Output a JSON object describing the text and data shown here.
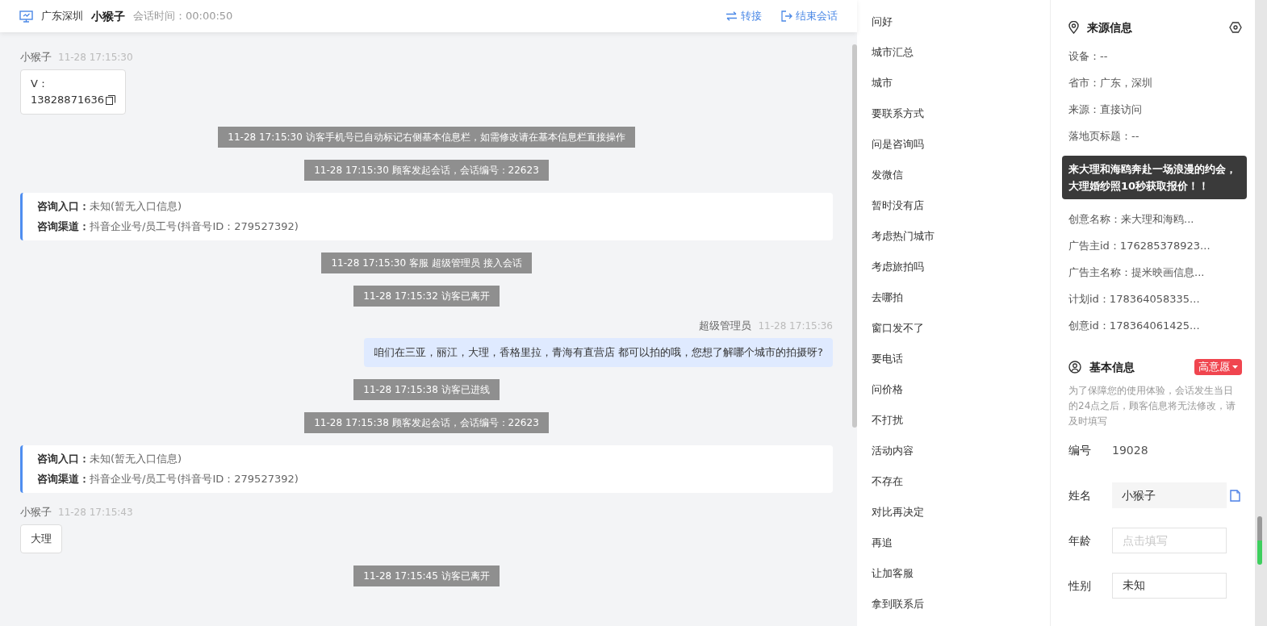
{
  "header": {
    "location": "广东深圳",
    "visitor": "小猴子",
    "timer_label": "会话时间：",
    "timer": "00:00:50",
    "actions": [
      {
        "kind": "transfer",
        "label": "转接"
      },
      {
        "kind": "end",
        "label": "结束会话"
      }
    ]
  },
  "messages": [
    {
      "kind": "visitor",
      "name": "小猴子",
      "time": "11-28 17:15:30",
      "lines": [
        "V：",
        "13828871636"
      ],
      "copyable": true
    },
    {
      "kind": "system",
      "text": "11-28 17:15:30 访客手机号已自动标记右侧基本信息栏，如需修改请在基本信息栏直接操作"
    },
    {
      "kind": "system",
      "text": "11-28 17:15:30 顾客发起会话，会话编号：22623"
    },
    {
      "kind": "info",
      "rows": [
        {
          "label": "咨询入口：",
          "value": "未知(暂无入口信息)"
        },
        {
          "label": "咨询渠道：",
          "value": "抖音企业号/员工号(抖音号ID：279527392)"
        }
      ]
    },
    {
      "kind": "system",
      "text": "11-28 17:15:30 客服 超级管理员 接入会话"
    },
    {
      "kind": "system",
      "text": "11-28 17:15:32 访客已离开"
    },
    {
      "kind": "agent",
      "name": "超级管理员",
      "time": "11-28 17:15:36",
      "lines": [
        "咱们在三亚，丽江，大理，香格里拉，青海有直营店 都可以拍的哦，您想了解哪个城市的拍摄呀?"
      ]
    },
    {
      "kind": "system",
      "text": "11-28 17:15:38 访客已进线"
    },
    {
      "kind": "system",
      "text": "11-28 17:15:38 顾客发起会话，会话编号：22623"
    },
    {
      "kind": "info",
      "rows": [
        {
          "label": "咨询入口：",
          "value": "未知(暂无入口信息)"
        },
        {
          "label": "咨询渠道：",
          "value": "抖音企业号/员工号(抖音号ID：279527392)"
        }
      ]
    },
    {
      "kind": "visitor",
      "name": "小猴子",
      "time": "11-28 17:15:43",
      "lines": [
        "大理"
      ],
      "copyable": false
    },
    {
      "kind": "system",
      "text": "11-28 17:15:45 访客已离开"
    }
  ],
  "quick_replies": [
    "问好",
    "城市汇总",
    "城市",
    "要联系方式",
    "问是咨询吗",
    "发微信",
    "暂时没有店",
    "考虑热门城市",
    "考虑旅拍吗",
    "去哪拍",
    "窗口发不了",
    "要电话",
    "问价格",
    "不打扰",
    "活动内容",
    "不存在",
    "对比再决定",
    "再追",
    "让加客服",
    "拿到联系后"
  ],
  "source_info": {
    "title": "来源信息",
    "rows_before": [
      "设备：--",
      "省市：广东，深圳",
      "来源：直接访问",
      "落地页标题：--"
    ],
    "tooltip": "来大理和海鸥奔赴一场浪漫的约会，大理婚纱照10秒获取报价！！",
    "rows_after": [
      "创意名称：来大理和海鸥...",
      "广告主id：176285378923...",
      "广告主名称：提米映画信息...",
      "计划id：178364058335...",
      "创意id：178364061425..."
    ]
  },
  "basic_info": {
    "title": "基本信息",
    "intent": "高意愿",
    "notice": "为了保障您的使用体验，会话发生当日的24点之后，顾客信息将无法修改，请及时填写",
    "fields": [
      {
        "kind": "text",
        "label": "编号",
        "value": "19028"
      },
      {
        "kind": "readonly",
        "label": "姓名",
        "value": "小猴子"
      },
      {
        "kind": "input",
        "label": "年龄",
        "placeholder": "点击填写"
      },
      {
        "kind": "input",
        "label": "性别",
        "value": "未知"
      }
    ]
  }
}
